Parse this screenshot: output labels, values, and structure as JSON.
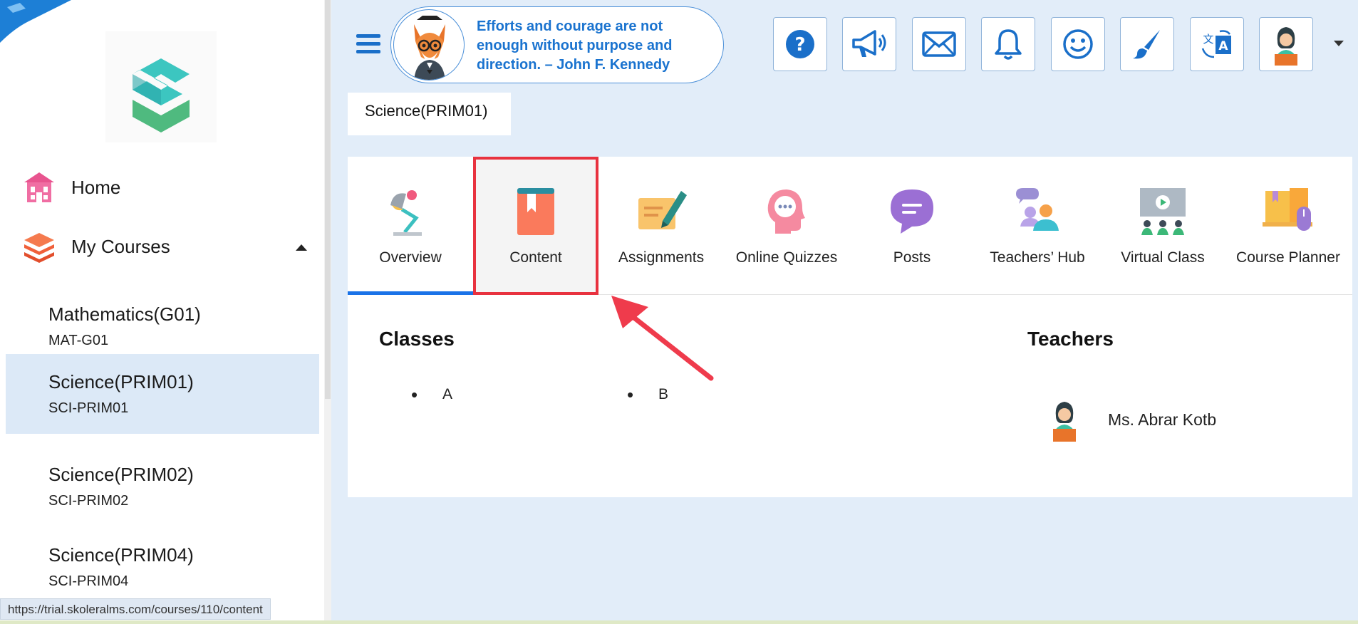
{
  "sidebar": {
    "nav": {
      "home_label": "Home",
      "courses_label": "My Courses"
    },
    "courses": [
      {
        "name": "Mathematics(G01)",
        "code": "MAT-G01",
        "active": false
      },
      {
        "name": "Science(PRIM01)",
        "code": "SCI-PRIM01",
        "active": true
      },
      {
        "name": "Science(PRIM02)",
        "code": "SCI-PRIM02",
        "active": false
      },
      {
        "name": "Science(PRIM04)",
        "code": "SCI-PRIM04",
        "active": false
      }
    ]
  },
  "header": {
    "quote_lines": [
      "Efforts and courage are not",
      "enough without purpose and",
      "direction. – John F. Kennedy"
    ],
    "toolbar_icons": [
      "help-icon",
      "megaphone-icon",
      "mail-icon",
      "bell-icon",
      "smiley-icon",
      "brush-icon",
      "translate-icon",
      "avatar-icon"
    ]
  },
  "breadcrumb": {
    "label": "Science(PRIM01)"
  },
  "tabs": [
    {
      "label": "Overview",
      "icon": "lamp-icon",
      "selected": true
    },
    {
      "label": "Content",
      "icon": "book-icon",
      "highlighted": true
    },
    {
      "label": "Assignments",
      "icon": "assignment-icon"
    },
    {
      "label": "Online Quizzes",
      "icon": "quiz-icon"
    },
    {
      "label": "Posts",
      "icon": "chat-icon"
    },
    {
      "label": "Teachers’ Hub",
      "icon": "teachers-hub-icon"
    },
    {
      "label": "Virtual Class",
      "icon": "virtual-class-icon"
    },
    {
      "label": "Course Planner",
      "icon": "course-planner-icon"
    }
  ],
  "overview": {
    "classes_title": "Classes",
    "classes": [
      "A",
      "B"
    ],
    "teachers_title": "Teachers",
    "teachers": [
      "Ms. Abrar Kotb"
    ]
  },
  "status_bar": {
    "url": "https://trial.skoleralms.com/courses/110/content"
  },
  "colors": {
    "accent": "#1a73e8",
    "highlight": "#e8323f",
    "background": "#e2edf9"
  }
}
